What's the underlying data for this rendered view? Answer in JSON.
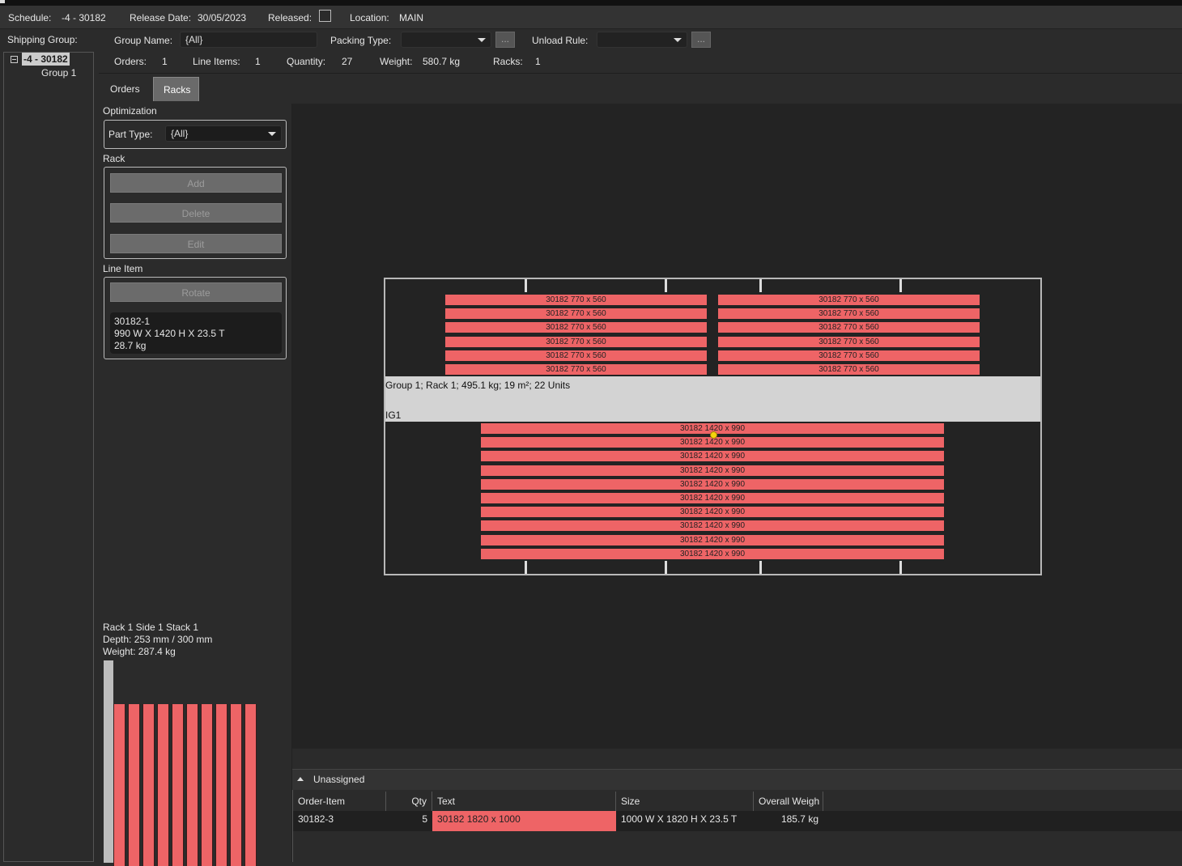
{
  "header": {
    "schedule_label": "Schedule:",
    "schedule_value": "-4 - 30182",
    "release_label": "Release Date:",
    "release_value": "30/05/2023",
    "released_label": "Released:",
    "location_label": "Location:",
    "location_value": "MAIN"
  },
  "shipping": {
    "label": "Shipping Group:",
    "tree": {
      "root": "-4 - 30182",
      "child": "Group 1"
    }
  },
  "group": {
    "name_label": "Group Name:",
    "name_value": "{All}",
    "packing_label": "Packing Type:",
    "packing_value": "",
    "unload_label": "Unload Rule:",
    "unload_value": "",
    "ellipsis": "...",
    "stats": {
      "orders_label": "Orders:",
      "orders_value": "1",
      "line_items_label": "Line Items:",
      "line_items_value": "1",
      "quantity_label": "Quantity:",
      "quantity_value": "27",
      "weight_label": "Weight:",
      "weight_value": "580.7 kg",
      "racks_label": "Racks:",
      "racks_value": "1"
    }
  },
  "tabs": [
    {
      "label": "Orders"
    },
    {
      "label": "Racks"
    }
  ],
  "controls": {
    "optimization_label": "Optimization",
    "part_type_label": "Part Type:",
    "part_type_value": "{All}",
    "rack_label": "Rack",
    "add_label": "Add",
    "delete_label": "Delete",
    "edit_label": "Edit",
    "line_item_label": "Line Item",
    "rotate_label": "Rotate",
    "item": {
      "id": "30182-1",
      "dims": "990 W X 1420 H X 23.5 T",
      "weight": "28.7 kg"
    },
    "stack": {
      "title": "Rack 1 Side 1 Stack 1",
      "depth": "Depth:  253 mm  /  300 mm",
      "weight": "Weight:  287.4 kg",
      "fill_fraction": 0.843
    }
  },
  "rack_view": {
    "caption": "Group 1;  Rack 1;  495.1 kg;  19 m²;  22 Units",
    "ig_label": "IG1",
    "top_left_label": "30182 770 x 560",
    "top_right_label": "30182 770 x 560",
    "bottom_label": "30182 1420 x 990"
  },
  "unassigned": {
    "title": "Unassigned",
    "columns": [
      "Order-Item",
      "Qty",
      "Text",
      "Size",
      "Overall Weigh"
    ],
    "rows": [
      {
        "order_item": "30182-3",
        "qty": "5",
        "text": "30182 1820 x 1000",
        "size": "1000 W X 1820 H X 23.5 T",
        "weight": "185.7 kg"
      }
    ]
  },
  "colors": {
    "glass": "#ee6466",
    "background": "#2b2b2b",
    "canvas": "#232323"
  }
}
